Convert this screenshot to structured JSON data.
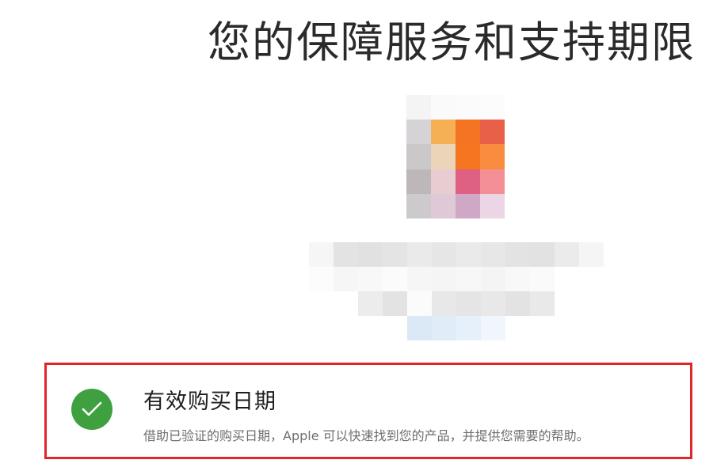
{
  "page": {
    "title": "您的保障服务和支持期限"
  },
  "product": {
    "image_tiles": [
      "#f4f4f4",
      "#fafafa",
      "#fbfbfb",
      "#fcfcfc",
      "#d5d3d6",
      "#f5b055",
      "#f47423",
      "#e96048",
      "#cbc8ca",
      "#ecd4b8",
      "#f57520",
      "#f98c3e",
      "#bdb7b9",
      "#e7cdd2",
      "#de6184",
      "#f49095",
      "#cdcacd",
      "#e0c9d6",
      "#cfa8c5",
      "#ecd5e4"
    ]
  },
  "blurred_info": {
    "rows": [
      [
        "#f6f6f6",
        "#e3e3e3",
        "#e1e1e1",
        "#e4e4e4",
        "#eaeaea",
        "#e6e6e6",
        "#eaeaea",
        "#e7e7e7",
        "#e3e3e3",
        "#e2e2e2",
        "#ebebeb",
        "#f5f5f5"
      ],
      [
        "#fcfcfc",
        "#f6f6f6",
        "#f8f8f8",
        "#fbfbfb",
        "#f6f6f6",
        "#f5f5f5",
        "#f7f7f7",
        "#f4f4f4",
        "#f8f8f8",
        "#fafafa"
      ],
      [
        "#ececec",
        "#e3e3e3",
        "#fbfbfb",
        "#e8e8e8",
        "#e5e5e5",
        "#e8e8e8",
        "#e3e3e3",
        "#e9e9e9"
      ],
      [
        "#dbe9f7",
        "#e0ecf8",
        "#e5f0fa",
        "#f1f6fc"
      ]
    ]
  },
  "purchase_card": {
    "title": "有效购买日期",
    "description": "借助已验证的购买日期，Apple 可以快速找到您的产品，并提供您需要的帮助。",
    "status_icon": "checkmark-circle-icon",
    "status_color": "#3fa03f",
    "highlight_color": "#e0262b"
  }
}
